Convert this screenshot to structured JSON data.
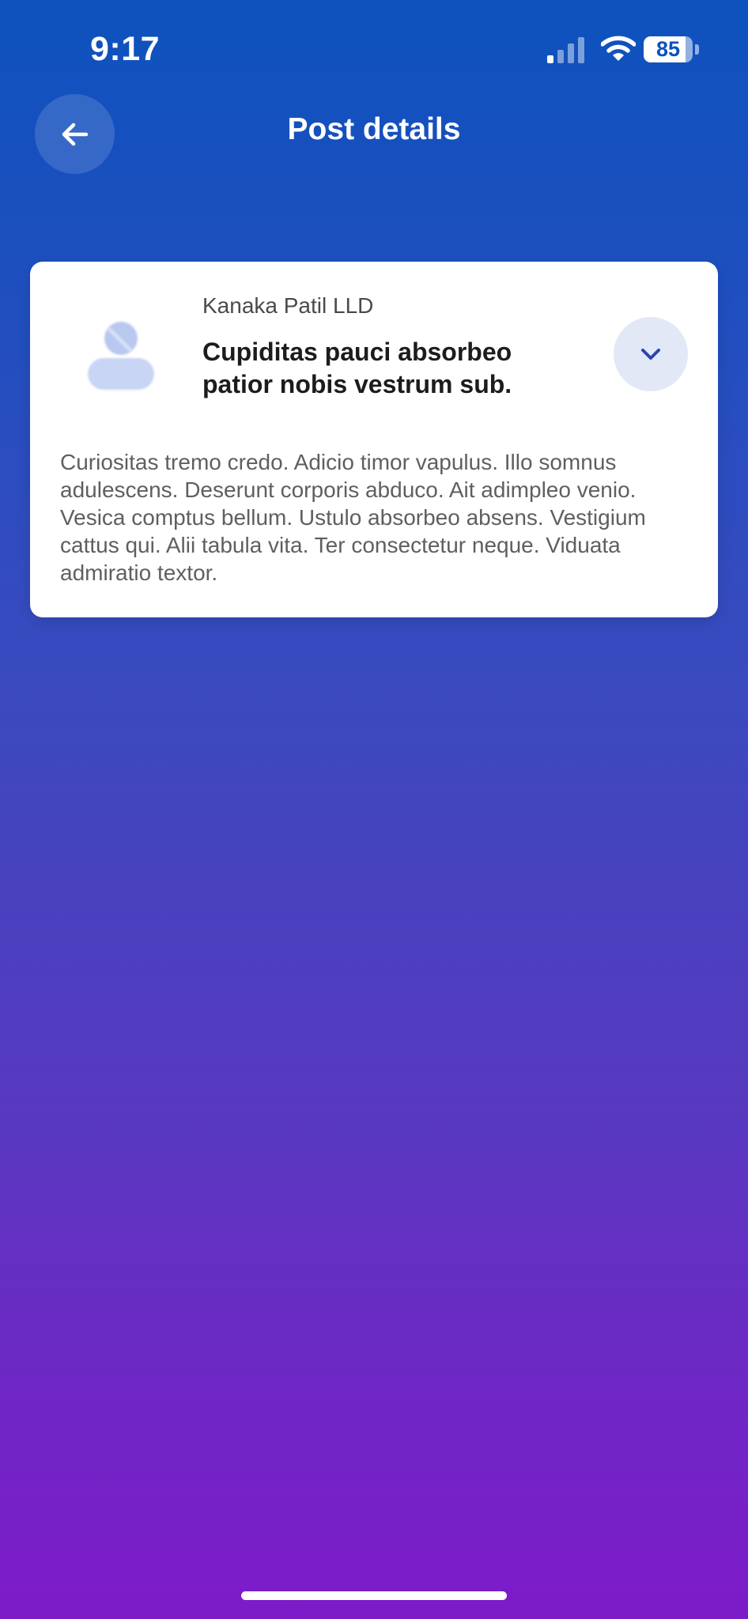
{
  "status_bar": {
    "time": "9:17",
    "battery_level": "85",
    "battery_fraction": 0.85,
    "signal_icon": "cellular-signal-icon",
    "wifi_icon": "wifi-icon"
  },
  "nav": {
    "back_icon": "arrow-left-icon",
    "title": "Post details"
  },
  "post": {
    "author": "Kanaka Patil LLD",
    "title": "Cupiditas pauci absorbeo patior nobis vestrum sub.",
    "body": "Curiositas tremo credo. Adicio timor vapulus. Illo somnus adulescens. Deserunt corporis abduco. Ait adimpleo venio. Vesica comptus bellum. Ustulo absorbeo absens. Vestigium cattus qui. Alii tabula vita. Ter consectetur neque. Viduata admiratio textor.",
    "avatar_icon": "user-avatar-icon",
    "expand_icon": "chevron-down-icon"
  },
  "colors": {
    "gradient_top": "#0d52bd",
    "gradient_bottom": "#7d1bc9",
    "accent": "#2b45b0",
    "card_background": "#ffffff"
  }
}
